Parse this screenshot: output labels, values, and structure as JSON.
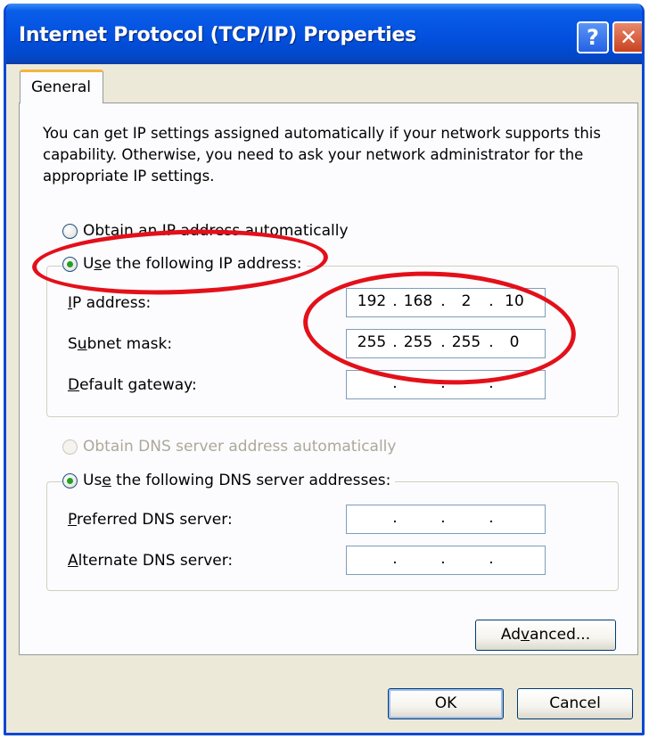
{
  "window": {
    "title": "Internet Protocol (TCP/IP) Properties",
    "help_glyph": "?",
    "close_glyph": "✕"
  },
  "tabs": [
    {
      "label": "General",
      "selected": true
    }
  ],
  "description": "You can get IP settings assigned automatically if your network supports this capability. Otherwise, you need to ask your network administrator for the appropriate IP settings.",
  "ip": {
    "auto_option": {
      "label": "Obtain an IP address automatically",
      "selected": false
    },
    "manual_option": {
      "label_pre": "U",
      "label_key": "s",
      "label_post": "e the following IP address:",
      "selected": true
    },
    "fields": {
      "ip_address": {
        "label_key": "I",
        "label_rest": "P address:",
        "octets": [
          "192",
          "168",
          "2",
          "10"
        ]
      },
      "subnet_mask": {
        "label_pre": "S",
        "label_key": "u",
        "label_post": "bnet mask:",
        "octets": [
          "255",
          "255",
          "255",
          "0"
        ]
      },
      "default_gateway": {
        "label_key": "D",
        "label_rest": "efault gateway:",
        "octets": [
          "",
          "",
          "",
          ""
        ]
      }
    }
  },
  "dns": {
    "auto_option": {
      "label": "Obtain DNS server address automatically",
      "selected": false,
      "disabled": true
    },
    "manual_option": {
      "label_pre": "Use the following DNS server addresses:",
      "selected": true
    },
    "fields": {
      "preferred": {
        "label_key": "P",
        "label_rest": "referred DNS server:",
        "octets": [
          "",
          "",
          "",
          ""
        ]
      },
      "alternate": {
        "label_key": "A",
        "label_rest": "lternate DNS server:",
        "octets": [
          "",
          "",
          "",
          ""
        ]
      }
    }
  },
  "buttons": {
    "advanced_pre": "Ad",
    "advanced_key": "v",
    "advanced_post": "anced...",
    "ok": "OK",
    "cancel": "Cancel"
  },
  "annotation_color": "#e3101a",
  "title_bar_color": "#0350df"
}
